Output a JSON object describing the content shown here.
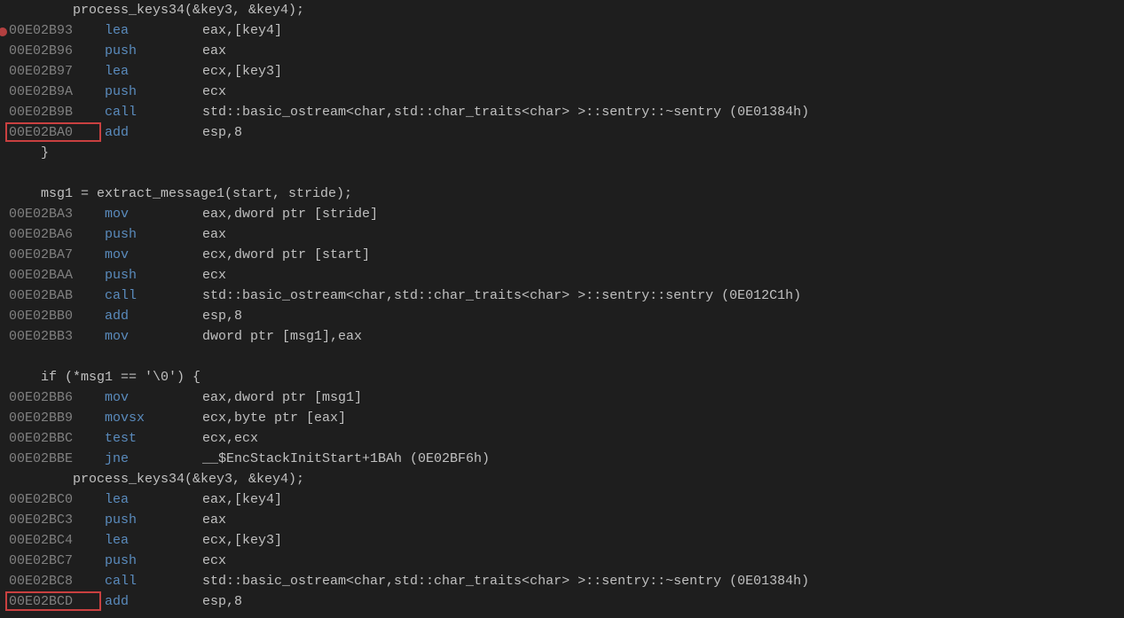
{
  "lines": [
    {
      "type": "src",
      "indent": "        ",
      "text": "process_keys34(&key3, &key4);"
    },
    {
      "type": "asm",
      "bp": true,
      "addr": "00E02B93",
      "mn": "lea",
      "ops": "eax,[key4]"
    },
    {
      "type": "asm",
      "addr": "00E02B96",
      "mn": "push",
      "ops": "eax"
    },
    {
      "type": "asm",
      "addr": "00E02B97",
      "mn": "lea",
      "ops": "ecx,[key3]"
    },
    {
      "type": "asm",
      "addr": "00E02B9A",
      "mn": "push",
      "ops": "ecx"
    },
    {
      "type": "asm",
      "addr": "00E02B9B",
      "mn": "call",
      "ops": "std::basic_ostream<char,std::char_traits<char> >::sentry::~sentry (0E01384h)"
    },
    {
      "type": "asm",
      "addr": "00E02BA0",
      "mn": "add",
      "ops": "esp,8",
      "box": true
    },
    {
      "type": "src",
      "indent": "    ",
      "text": "}"
    },
    {
      "type": "blank"
    },
    {
      "type": "src",
      "indent": "    ",
      "text": "msg1 = extract_message1(start, stride);"
    },
    {
      "type": "asm",
      "addr": "00E02BA3",
      "mn": "mov",
      "ops": "eax,dword ptr [stride]"
    },
    {
      "type": "asm",
      "addr": "00E02BA6",
      "mn": "push",
      "ops": "eax"
    },
    {
      "type": "asm",
      "addr": "00E02BA7",
      "mn": "mov",
      "ops": "ecx,dword ptr [start]"
    },
    {
      "type": "asm",
      "addr": "00E02BAA",
      "mn": "push",
      "ops": "ecx"
    },
    {
      "type": "asm",
      "addr": "00E02BAB",
      "mn": "call",
      "ops": "std::basic_ostream<char,std::char_traits<char> >::sentry::sentry (0E012C1h)"
    },
    {
      "type": "asm",
      "addr": "00E02BB0",
      "mn": "add",
      "ops": "esp,8"
    },
    {
      "type": "asm",
      "addr": "00E02BB3",
      "mn": "mov",
      "ops": "dword ptr [msg1],eax"
    },
    {
      "type": "blank"
    },
    {
      "type": "src",
      "indent": "    ",
      "text": "if (*msg1 == '\\0') {"
    },
    {
      "type": "asm",
      "addr": "00E02BB6",
      "mn": "mov",
      "ops": "eax,dword ptr [msg1]"
    },
    {
      "type": "asm",
      "addr": "00E02BB9",
      "mn": "movsx",
      "ops": "ecx,byte ptr [eax]"
    },
    {
      "type": "asm",
      "addr": "00E02BBC",
      "mn": "test",
      "ops": "ecx,ecx"
    },
    {
      "type": "asm",
      "addr": "00E02BBE",
      "mn": "jne",
      "ops": "__$EncStackInitStart+1BAh (0E02BF6h)"
    },
    {
      "type": "src",
      "indent": "        ",
      "text": "process_keys34(&key3, &key4);"
    },
    {
      "type": "asm",
      "addr": "00E02BC0",
      "mn": "lea",
      "ops": "eax,[key4]"
    },
    {
      "type": "asm",
      "addr": "00E02BC3",
      "mn": "push",
      "ops": "eax"
    },
    {
      "type": "asm",
      "addr": "00E02BC4",
      "mn": "lea",
      "ops": "ecx,[key3]"
    },
    {
      "type": "asm",
      "addr": "00E02BC7",
      "mn": "push",
      "ops": "ecx"
    },
    {
      "type": "asm",
      "addr": "00E02BC8",
      "mn": "call",
      "ops": "std::basic_ostream<char,std::char_traits<char> >::sentry::~sentry (0E01384h)"
    },
    {
      "type": "asm",
      "addr": "00E02BCD",
      "mn": "add",
      "ops": "esp,8",
      "box": true
    }
  ]
}
